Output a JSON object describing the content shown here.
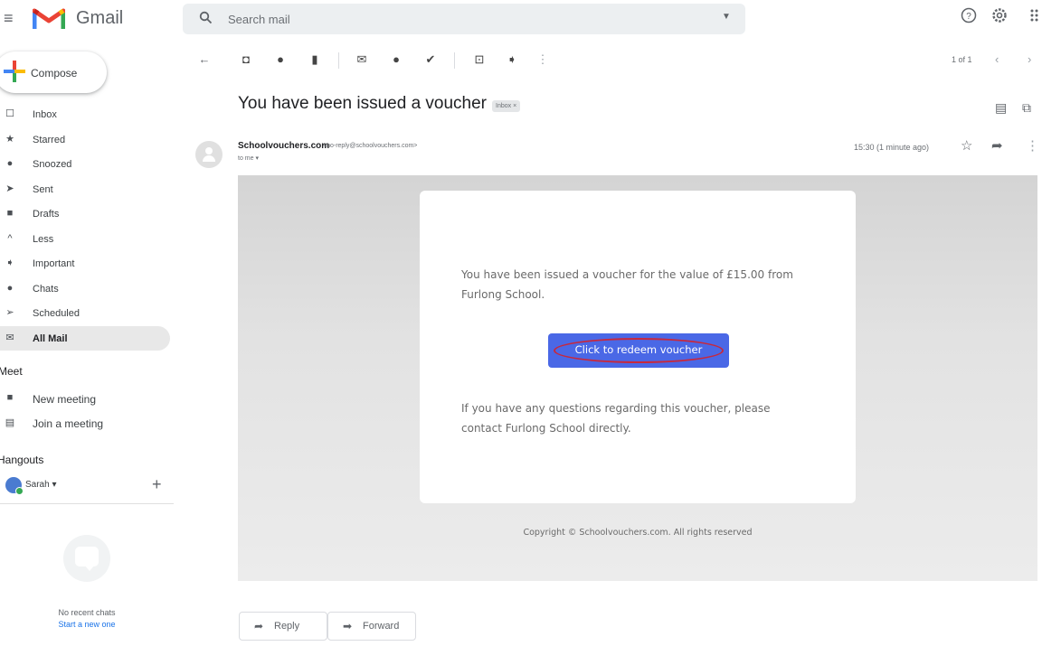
{
  "app": {
    "name": "Gmail",
    "colors": {
      "red": "#ea4335",
      "blue": "#4285f4",
      "yellow": "#fbbc04",
      "green": "#34a853",
      "redeem_button": "#4a68e6",
      "annotation_oval": "#c8283c"
    }
  },
  "search": {
    "placeholder": "Search mail"
  },
  "top_right": {
    "icons": [
      "help-icon",
      "settings-icon",
      "apps-grid-icon"
    ]
  },
  "compose": {
    "label": "Compose"
  },
  "sidebar": {
    "items": [
      {
        "label": "Inbox",
        "icon": "inbox-icon"
      },
      {
        "label": "Starred",
        "icon": "star-icon"
      },
      {
        "label": "Snoozed",
        "icon": "clock-icon"
      },
      {
        "label": "Sent",
        "icon": "send-icon"
      },
      {
        "label": "Drafts",
        "icon": "draft-icon"
      },
      {
        "label": "Less",
        "icon": "chevron-up-icon"
      },
      {
        "label": "Important",
        "icon": "important-icon"
      },
      {
        "label": "Chats",
        "icon": "chat-icon"
      },
      {
        "label": "Scheduled",
        "icon": "schedule-send-icon"
      },
      {
        "label": "All Mail",
        "icon": "all-mail-icon",
        "active": true
      }
    ]
  },
  "meet": {
    "title": "Meet",
    "items": [
      {
        "label": "New meeting",
        "icon": "video-camera-icon"
      },
      {
        "label": "Join a meeting",
        "icon": "keyboard-icon"
      }
    ]
  },
  "hangouts": {
    "title": "Hangouts",
    "user": "Sarah",
    "no_chats": "No recent chats",
    "start_new": "Start a new one"
  },
  "toolbar": {
    "icons": [
      "back-arrow-icon",
      "archive-icon",
      "report-spam-icon",
      "delete-icon",
      "mark-unread-icon",
      "snooze-icon",
      "add-task-icon",
      "move-to-icon",
      "label-icon",
      "more-vert-icon"
    ],
    "pager": "1 of 1"
  },
  "email": {
    "subject": "You have been issued a voucher",
    "label_chip": "Inbox ×",
    "sender_name": "Schoolvouchers.com",
    "sender_email": "<no-reply@schoolvouchers.com>",
    "to": "to me ▾",
    "time": "15:30 (1 minute ago)",
    "body_line1": "You have been issued a voucher for the value of £15.00 from",
    "body_line2": "Furlong School.",
    "redeem_label": "Click to redeem voucher",
    "questions_line1": "If you have any questions regarding this voucher, please",
    "questions_line2": "contact Furlong School directly.",
    "copyright": "Copyright © Schoolvouchers.com. All rights reserved"
  },
  "actions": {
    "reply": "Reply",
    "forward": "Forward"
  }
}
